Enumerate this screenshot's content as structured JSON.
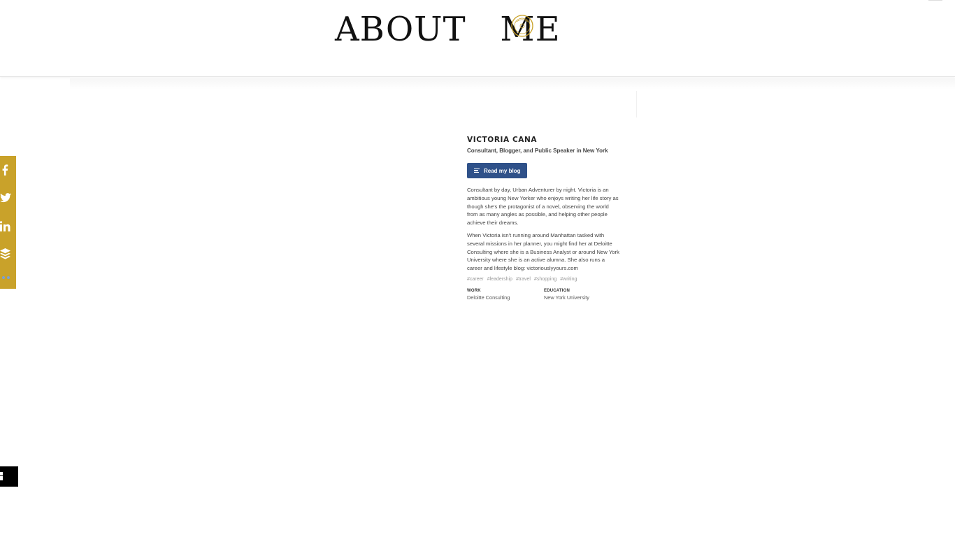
{
  "header": {
    "title": "ABOUT   ME",
    "logo_icon": "seal-logo-icon",
    "accent": "#c9a22a"
  },
  "share_bar": {
    "color": "#c9a22a",
    "items": [
      {
        "icon": "facebook-icon"
      },
      {
        "icon": "twitter-icon"
      },
      {
        "icon": "linkedin-icon"
      },
      {
        "icon": "buffer-icon"
      },
      {
        "icon": "more-icon"
      }
    ]
  },
  "profile": {
    "name": "VICTORIA CANA",
    "tagline": "Consultant, Blogger, and Public Speaker in New York",
    "blog_button": "Read my blog",
    "button_color": "#2f5189",
    "bio": [
      "Consultant by day, Urban Adventurer by night. Victoria is an ambitious young New Yorker who enjoys writing her life story as though she's the protagonist of a novel, observing the world from as many angles as possible, and helping other people achieve their dreams.",
      "When Victoria isn't running around Manhattan tasked with several missions in her planner, you might find her at Deloitte Consulting where she is a Business Analyst or around New York University where she is an active alumna. She also runs a career and lifestyle blog: victoriouslyyours.com"
    ],
    "tags": [
      "#career",
      "#leadership",
      "#travel",
      "#shopping",
      "#writing"
    ],
    "facts": [
      {
        "label": "WORK",
        "value": "Deloitte Consulting"
      },
      {
        "label": "EDUCATION",
        "value": "New York University"
      }
    ]
  }
}
